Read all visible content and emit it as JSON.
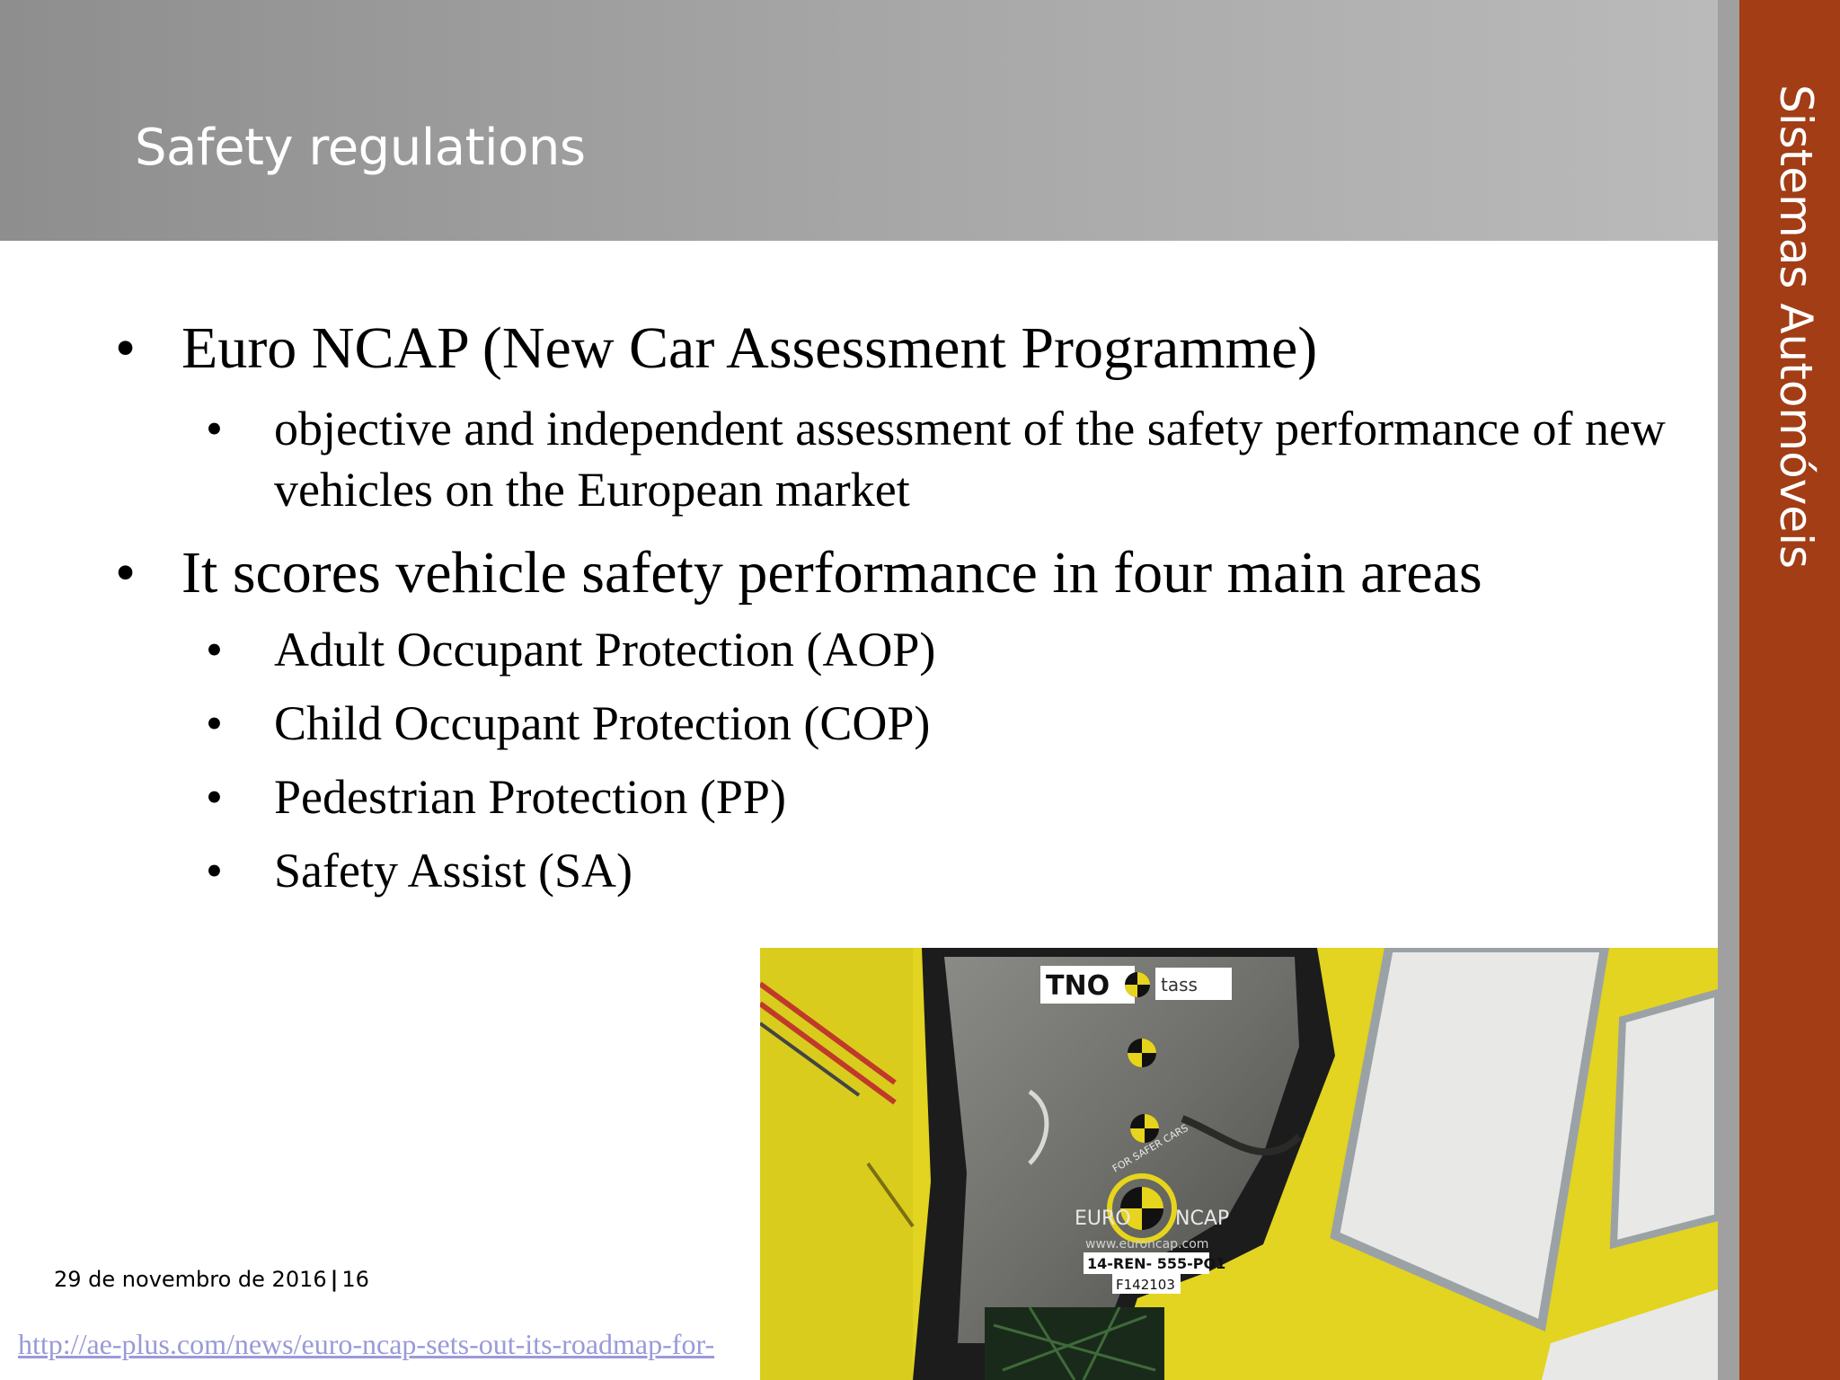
{
  "slide": {
    "title": "Safety regulations",
    "side_title": "Sistemas Automóveis",
    "bullets": [
      {
        "text": "Euro NCAP (New Car Assessment Programme)",
        "sub": [
          "objective and independent assessment of the safety performance of new vehicles on the European market"
        ]
      },
      {
        "text": "It scores vehicle safety performance in four main areas",
        "sub": [
          "Adult Occupant Protection (AOP)",
          "Child Occupant Protection (COP)",
          "Pedestrian Protection (PP)",
          "Safety Assist (SA)"
        ]
      }
    ],
    "bullet_symbol": "•",
    "footer": {
      "date": "29 de novembro de 2016",
      "separator": "|",
      "page": "16"
    },
    "source_link": "http://ae-plus.com/news/euro-ncap-sets-out-its-roadmap-for-"
  },
  "photo": {
    "description_icon": "crash-test-photo",
    "logos": {
      "tno": "TNO",
      "tass": "tass",
      "euro": "EURO",
      "ncap": "NCAP",
      "ring": "FOR SAFER CARS",
      "website": "www.euroncap.com",
      "plate1": "14-REN- 555-PO1",
      "plate2": "F142103"
    }
  },
  "colors": {
    "accent": "#a23d15",
    "header_gray": "#a6a6a6",
    "link": "#9a9ad8"
  }
}
